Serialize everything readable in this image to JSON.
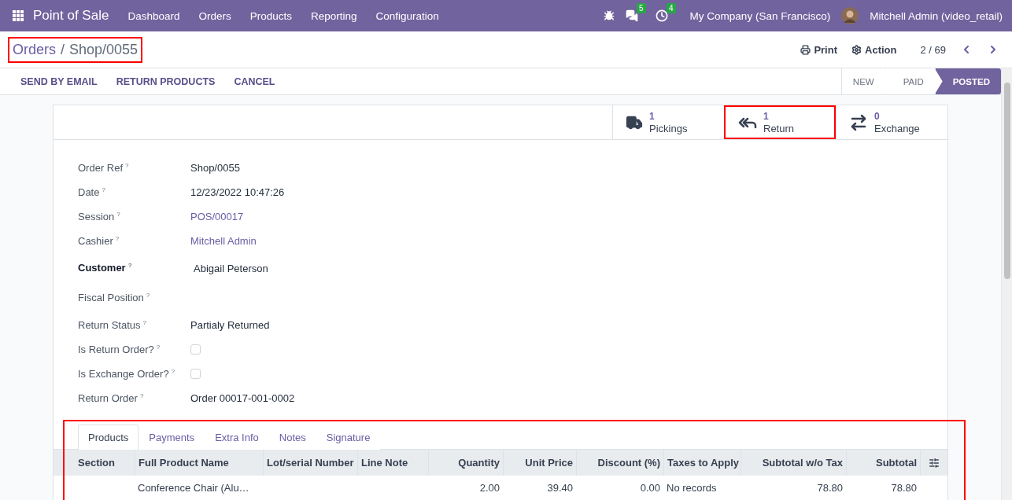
{
  "navbar": {
    "app": "Point of Sale",
    "menu": [
      "Dashboard",
      "Orders",
      "Products",
      "Reporting",
      "Configuration"
    ],
    "messages_count": "5",
    "activities_count": "4",
    "company": "My Company (San Francisco)",
    "user": "Mitchell Admin (video_retail)"
  },
  "breadcrumb": {
    "parent": "Orders",
    "separator": "/",
    "current": "Shop/0055",
    "highlighted": true
  },
  "actions": [
    "Print",
    "Action"
  ],
  "pager": "2 / 69",
  "buttons": [
    "SEND BY EMAIL",
    "RETURN PRODUCTS",
    "CANCEL"
  ],
  "status_steps": [
    {
      "label": "NEW",
      "selected": false
    },
    {
      "label": "PAID",
      "selected": false
    },
    {
      "label": "POSTED",
      "selected": true
    }
  ],
  "smart_buttons": [
    {
      "kind": "truck",
      "count": "1",
      "label": "Pickings",
      "highlighted": false
    },
    {
      "kind": "return",
      "count": "1",
      "label": "Return",
      "highlighted": true
    },
    {
      "kind": "exchange",
      "count": "0",
      "label": "Exchange",
      "highlighted": false
    }
  ],
  "fields": [
    {
      "label": "Order Ref",
      "help": "?",
      "kind": "text",
      "value": "Shop/0055",
      "bold": false
    },
    {
      "label": "Date",
      "help": "?",
      "kind": "text",
      "value": "12/23/2022 10:47:26",
      "bold": false
    },
    {
      "label": "Session",
      "help": "?",
      "kind": "link",
      "value": "POS/00017",
      "bold": false
    },
    {
      "label": "Cashier",
      "help": "?",
      "kind": "link",
      "value": "Mitchell Admin",
      "bold": false
    },
    {
      "label": "Customer",
      "help": "?",
      "kind": "text",
      "value": "Abigail Peterson",
      "bold": true
    },
    {
      "label": "Fiscal Position",
      "help": "?",
      "kind": "empty",
      "bold": false
    },
    {
      "label": "Return Status",
      "help": "?",
      "kind": "text",
      "value": "Partialy Returned",
      "bold": false
    },
    {
      "label": "Is Return Order?",
      "help": "?",
      "kind": "checkbox",
      "checked": false,
      "bold": false
    },
    {
      "label": "Is Exchange Order?",
      "help": "?",
      "kind": "checkbox",
      "checked": false,
      "bold": false
    },
    {
      "label": "Return Order",
      "help": "?",
      "kind": "text",
      "value": "Order 00017-001-0002",
      "bold": false
    }
  ],
  "notebook": {
    "highlighted": true,
    "tabs": [
      {
        "label": "Products",
        "selected": true
      },
      {
        "label": "Payments",
        "selected": false
      },
      {
        "label": "Extra Info",
        "selected": false
      },
      {
        "label": "Notes",
        "selected": false
      },
      {
        "label": "Signature",
        "selected": false
      }
    ],
    "columns": [
      {
        "label": "Section",
        "numeric": false
      },
      {
        "label": "Full Product Name",
        "numeric": false
      },
      {
        "label": "Lot/serial Number",
        "numeric": false
      },
      {
        "label": "Line Note",
        "numeric": false
      },
      {
        "label": "Quantity",
        "numeric": true
      },
      {
        "label": "Unit Price",
        "numeric": true
      },
      {
        "label": "Discount (%)",
        "numeric": true
      },
      {
        "label": "Taxes to Apply",
        "numeric": false
      },
      {
        "label": "Subtotal w/o Tax",
        "numeric": true
      },
      {
        "label": "Subtotal",
        "numeric": true
      }
    ],
    "rows": [
      {
        "cells": [
          "",
          "Conference Chair (Alu…",
          "",
          "",
          "2.00",
          "39.40",
          "0.00",
          "No records",
          "78.80",
          "78.80"
        ]
      }
    ]
  }
}
